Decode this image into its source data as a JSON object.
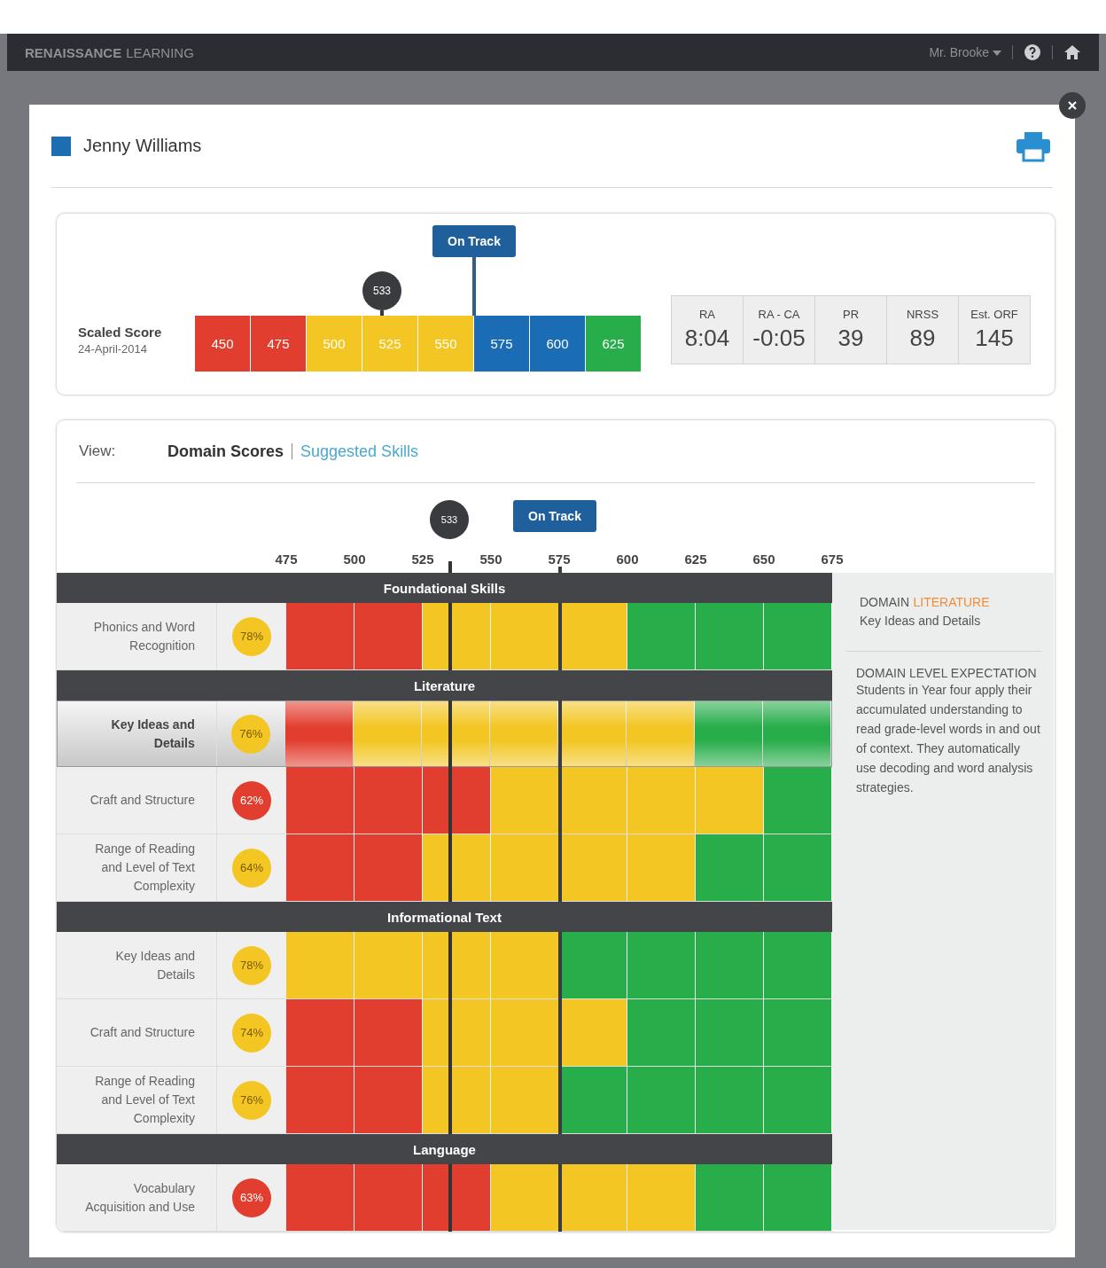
{
  "top_bar": {
    "brand_bold": "RENAISSANCE",
    "brand_light": "LEARNING",
    "user": "Mr. Brooke"
  },
  "student": {
    "name": "Jenny Williams"
  },
  "scaled_score": {
    "label": "Scaled Score",
    "date": "24-April-2014",
    "score": "533",
    "target_label": "On Track",
    "segments": [
      {
        "value": "450",
        "color": "#e23e2f"
      },
      {
        "value": "475",
        "color": "#e23e2f"
      },
      {
        "value": "500",
        "color": "#f3c623"
      },
      {
        "value": "525",
        "color": "#f3c623"
      },
      {
        "value": "550",
        "color": "#f3c623"
      },
      {
        "value": "575",
        "color": "#1a6cb5"
      },
      {
        "value": "600",
        "color": "#1a6cb5"
      },
      {
        "value": "625",
        "color": "#27ad4a"
      }
    ]
  },
  "stats": [
    {
      "label": "RA",
      "value": "8:04"
    },
    {
      "label": "RA - CA",
      "value": "-0:05"
    },
    {
      "label": "PR",
      "value": "39"
    },
    {
      "label": "NRSS",
      "value": "89"
    },
    {
      "label": "Est. ORF",
      "value": "145"
    }
  ],
  "view": {
    "label": "View:",
    "options": [
      {
        "label": "Domain Scores",
        "selected": true
      },
      {
        "label": "Suggested Skills",
        "selected": false
      }
    ]
  },
  "domain_chart": {
    "score": "533",
    "target_label": "On Track",
    "ticks": [
      "475",
      "500",
      "525",
      "550",
      "575",
      "600",
      "625",
      "650",
      "675"
    ],
    "groups": [
      {
        "title": "Foundational Skills",
        "rows": [
          {
            "skill": "Phonics and Word Recognition",
            "percent": "78%",
            "color": "#f3c623",
            "selected": false,
            "cells": [
              {
                "color": "#e23e2f"
              },
              {
                "color": "#e23e2f"
              },
              {
                "color": "#f3c623"
              },
              {
                "color": "#f3c623"
              },
              {
                "color": "#f3c623"
              },
              {
                "color": "#27ad4a"
              },
              {
                "color": "#27ad4a"
              },
              {
                "color": "#27ad4a"
              }
            ]
          }
        ]
      },
      {
        "title": "Literature",
        "rows": [
          {
            "skill": "Key Ideas and Details",
            "percent": "76%",
            "color": "#f3c623",
            "selected": true,
            "cells": [
              {
                "color": "#e23e2f"
              },
              {
                "color": "#f3c623"
              },
              {
                "color": "#f3c623"
              },
              {
                "color": "#f3c623"
              },
              {
                "color": "#f3c623"
              },
              {
                "color": "#f3c623"
              },
              {
                "color": "#27ad4a"
              },
              {
                "color": "#27ad4a"
              }
            ]
          },
          {
            "skill": "Craft and Structure",
            "percent": "62%",
            "color": "#e23e2f",
            "selected": false,
            "cells": [
              {
                "color": "#e23e2f"
              },
              {
                "color": "#e23e2f"
              },
              {
                "color": "#e23e2f"
              },
              {
                "color": "#f3c623"
              },
              {
                "color": "#f3c623"
              },
              {
                "color": "#f3c623"
              },
              {
                "color": "#f3c623"
              },
              {
                "color": "#27ad4a"
              }
            ]
          },
          {
            "skill": "Range of Reading and Level of Text Complexity",
            "percent": "64%",
            "color": "#f3c623",
            "selected": false,
            "cells": [
              {
                "color": "#e23e2f"
              },
              {
                "color": "#e23e2f"
              },
              {
                "color": "#f3c623"
              },
              {
                "color": "#f3c623"
              },
              {
                "color": "#f3c623"
              },
              {
                "color": "#f3c623"
              },
              {
                "color": "#27ad4a"
              },
              {
                "color": "#27ad4a"
              }
            ]
          }
        ]
      },
      {
        "title": "Informational Text",
        "rows": [
          {
            "skill": "Key Ideas and Details",
            "percent": "78%",
            "color": "#f3c623",
            "selected": false,
            "cells": [
              {
                "color": "#f3c623"
              },
              {
                "color": "#f3c623"
              },
              {
                "color": "#f3c623"
              },
              {
                "color": "#f3c623"
              },
              {
                "color": "#27ad4a"
              },
              {
                "color": "#27ad4a"
              },
              {
                "color": "#27ad4a"
              },
              {
                "color": "#27ad4a"
              }
            ]
          },
          {
            "skill": "Craft and Structure",
            "percent": "74%",
            "color": "#f3c623",
            "selected": false,
            "cells": [
              {
                "color": "#e23e2f"
              },
              {
                "color": "#e23e2f"
              },
              {
                "color": "#f3c623"
              },
              {
                "color": "#f3c623"
              },
              {
                "color": "#f3c623"
              },
              {
                "color": "#27ad4a"
              },
              {
                "color": "#27ad4a"
              },
              {
                "color": "#27ad4a"
              }
            ]
          },
          {
            "skill": "Range of Reading and Level of Text Complexity",
            "percent": "76%",
            "color": "#f3c623",
            "selected": false,
            "cells": [
              {
                "color": "#e23e2f"
              },
              {
                "color": "#e23e2f"
              },
              {
                "color": "#f3c623"
              },
              {
                "color": "#f3c623"
              },
              {
                "color": "#27ad4a"
              },
              {
                "color": "#27ad4a"
              },
              {
                "color": "#27ad4a"
              },
              {
                "color": "#27ad4a"
              }
            ]
          }
        ]
      },
      {
        "title": "Language",
        "rows": [
          {
            "skill": "Vocabulary Acquisition and Use",
            "percent": "63%",
            "color": "#e23e2f",
            "selected": false,
            "cells": [
              {
                "color": "#e23e2f"
              },
              {
                "color": "#e23e2f"
              },
              {
                "color": "#e23e2f"
              },
              {
                "color": "#f3c623"
              },
              {
                "color": "#f3c623"
              },
              {
                "color": "#f3c623"
              },
              {
                "color": "#27ad4a"
              },
              {
                "color": "#27ad4a"
              }
            ]
          }
        ]
      }
    ]
  },
  "details": {
    "domain_label": "DOMAIN",
    "domain_value": "LITERATURE",
    "skill": "Key Ideas and Details",
    "expectation_title": "DOMAIN LEVEL EXPECTATION",
    "expectation_text": "Students in Year four apply their accumulated understanding to read grade-level words in and out of context. They automatically use decoding and word analysis strategies."
  }
}
